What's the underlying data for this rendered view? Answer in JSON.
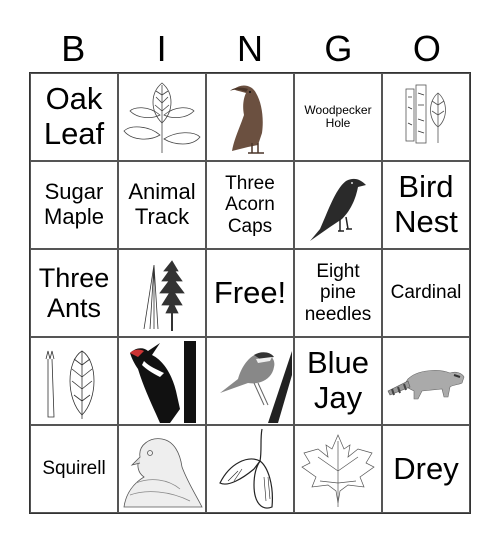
{
  "header": {
    "letters": [
      "B",
      "I",
      "N",
      "G",
      "O"
    ]
  },
  "cells": [
    {
      "type": "text",
      "label": "Oak\nLeaf",
      "size": "xl"
    },
    {
      "type": "image",
      "icon": "compound-leaf-icon",
      "desc": "Compound leaf sketch"
    },
    {
      "type": "image",
      "icon": "crow-brown-icon",
      "desc": "Brown crow illustration"
    },
    {
      "type": "text",
      "label": "Woodpecker\nHole",
      "size": "xs"
    },
    {
      "type": "image",
      "icon": "birch-bark-leaf-icon",
      "desc": "Birch bark and leaf sketch"
    },
    {
      "type": "text",
      "label": "Sugar\nMaple",
      "size": "md"
    },
    {
      "type": "text",
      "label": "Animal\nTrack",
      "size": "md"
    },
    {
      "type": "text",
      "label": "Three\nAcorn\nCaps",
      "size": "sm"
    },
    {
      "type": "image",
      "icon": "crow-black-icon",
      "desc": "Black crow sketch"
    },
    {
      "type": "text",
      "label": "Bird\nNest",
      "size": "xl"
    },
    {
      "type": "text",
      "label": "Three\nAnts",
      "size": "lg"
    },
    {
      "type": "image",
      "icon": "pine-tree-needles-icon",
      "desc": "Pine tree and needles sketch"
    },
    {
      "type": "text",
      "label": "Free!",
      "size": "xl",
      "free": true
    },
    {
      "type": "text",
      "label": "Eight\npine\nneedles",
      "size": "sm"
    },
    {
      "type": "text",
      "label": "Cardinal",
      "size": "sm"
    },
    {
      "type": "image",
      "icon": "twig-leaf-icon",
      "desc": "Twig and oval leaf sketch"
    },
    {
      "type": "image",
      "icon": "pileated-woodpecker-icon",
      "desc": "Pileated woodpecker on trunk"
    },
    {
      "type": "image",
      "icon": "sparrow-icon",
      "desc": "Sparrow on branch"
    },
    {
      "type": "text",
      "label": "Blue\nJay",
      "size": "xl"
    },
    {
      "type": "image",
      "icon": "raccoon-icon",
      "desc": "Raccoon sketch"
    },
    {
      "type": "text",
      "label": "Squirell",
      "size": "sm"
    },
    {
      "type": "image",
      "icon": "grouse-head-icon",
      "desc": "Grouse head sketch"
    },
    {
      "type": "image",
      "icon": "maple-seed-icon",
      "desc": "Maple samara seed"
    },
    {
      "type": "image",
      "icon": "maple-leaf-icon",
      "desc": "Maple leaf outline"
    },
    {
      "type": "text",
      "label": "Drey",
      "size": "xl"
    }
  ]
}
